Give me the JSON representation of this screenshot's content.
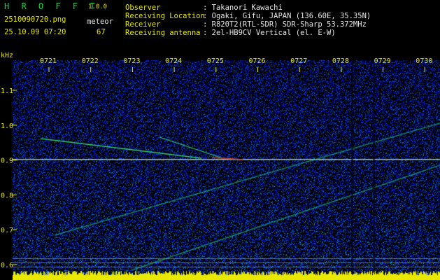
{
  "app": {
    "title": "H R O F F T",
    "version": "1.0.0"
  },
  "capture": {
    "filename": "2510090720.png",
    "datetime": "25.10.09 07:20",
    "meteor_label": "meteor",
    "meteor_count": "67"
  },
  "info": {
    "rows": [
      {
        "label": "Observer",
        "value": ": Takanori Kawachi"
      },
      {
        "label": "Receiving Location",
        "value": ": Ogaki, Gifu, JAPAN (136.60E, 35.35N)"
      },
      {
        "label": "Receiver",
        "value": ": R820T2(RTL-SDR) SDR-Sharp 53.372MHz"
      },
      {
        "label": "Receiving antenna",
        "value": ": 2el-HB9CV Vertical (el. E-W)"
      }
    ]
  },
  "axis": {
    "unit": "kHz",
    "y_ticks": [
      "1.1",
      "1.0",
      "0.9",
      "0.8",
      "0.7",
      "0.6"
    ],
    "x_ticks": [
      "0721",
      "0722",
      "0723",
      "0724",
      "0725",
      "0726",
      "0727",
      "0728",
      "0729",
      "0730"
    ]
  },
  "colors": {
    "background": "#000000",
    "text_yellow": "#e8e800",
    "text_white": "#e6e6e6",
    "logo_green": "#16d24a"
  }
}
